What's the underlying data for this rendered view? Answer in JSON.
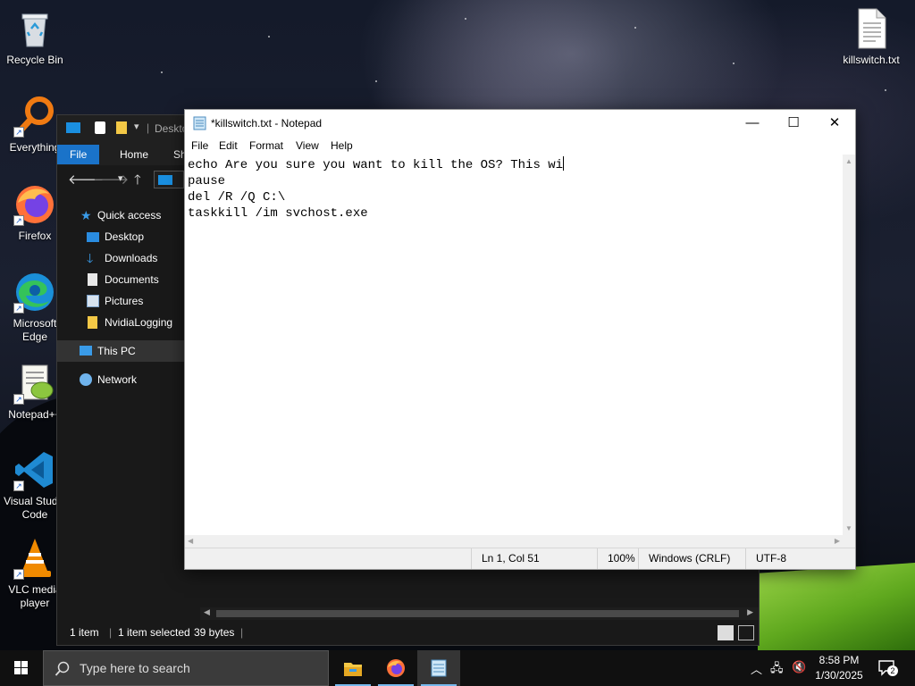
{
  "desktop": {
    "icons": [
      {
        "label": "Recycle Bin",
        "icon": "recycle-bin-icon"
      },
      {
        "label": "Everything",
        "icon": "everything-search-icon"
      },
      {
        "label": "Firefox",
        "icon": "firefox-icon"
      },
      {
        "label": "Microsoft Edge",
        "icon": "edge-icon"
      },
      {
        "label": "Notepad++",
        "icon": "notepad-plus-plus-icon"
      },
      {
        "label": "Visual Studio Code",
        "icon": "vscode-icon"
      },
      {
        "label": "VLC media player",
        "icon": "vlc-icon"
      },
      {
        "label": "killswitch.txt",
        "icon": "text-file-icon"
      }
    ]
  },
  "explorer": {
    "title_fragment": "Deskto",
    "ribbon_tabs": [
      "File",
      "Home",
      "Sh"
    ],
    "tree": [
      {
        "label": "Quick access",
        "icon": "star-icon"
      },
      {
        "label": "Desktop",
        "icon": "desktop-folder-icon"
      },
      {
        "label": "Downloads",
        "icon": "downloads-icon"
      },
      {
        "label": "Documents",
        "icon": "documents-icon"
      },
      {
        "label": "Pictures",
        "icon": "pictures-icon"
      },
      {
        "label": "NvidiaLogging",
        "icon": "folder-icon"
      },
      {
        "label": "This PC",
        "icon": "this-pc-icon"
      },
      {
        "label": "Network",
        "icon": "network-icon"
      }
    ],
    "status": {
      "items": "1 item",
      "selected": "1 item selected",
      "size": "39 bytes"
    }
  },
  "notepad": {
    "title": "*killswitch.txt - Notepad",
    "menu": [
      "File",
      "Edit",
      "Format",
      "View",
      "Help"
    ],
    "content_lines": [
      "echo Are you sure you want to kill the OS? This wi",
      "pause",
      "del /R /Q C:\\",
      "taskkill /im svchost.exe"
    ],
    "status": {
      "position": "Ln 1, Col 51",
      "zoom": "100%",
      "line_ending": "Windows (CRLF)",
      "encoding": "UTF-8"
    }
  },
  "taskbar": {
    "search_placeholder": "Type here to search",
    "apps": [
      "file-explorer-icon",
      "firefox-icon",
      "notepad-icon"
    ],
    "clock": {
      "time": "8:58 PM",
      "date": "1/30/2025"
    },
    "notifications_count": "2"
  },
  "colors": {
    "accent": "#1a73c9",
    "taskbar": "#101010",
    "explorer_bg": "#191919"
  }
}
